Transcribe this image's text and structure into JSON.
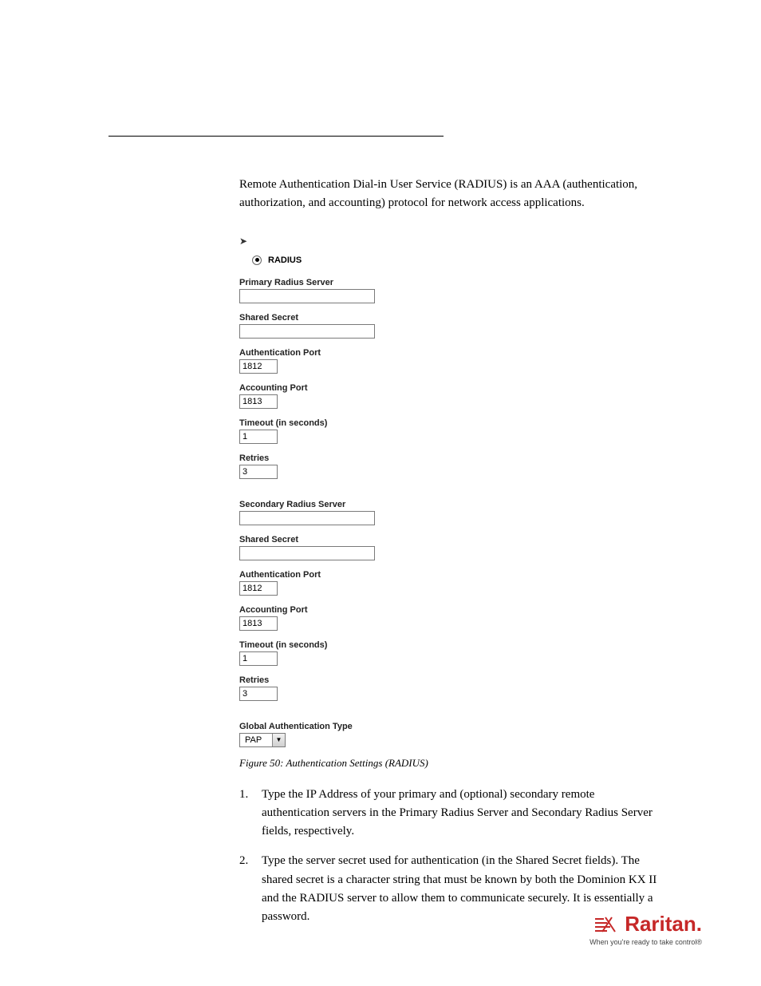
{
  "intro": "Remote Authentication Dial-in User Service (RADIUS) is an AAA (authentication, authorization, and accounting) protocol for network access applications.",
  "radius_form": {
    "radio_label": "RADIUS",
    "primary": {
      "server_label": "Primary Radius Server",
      "server_value": "",
      "shared_secret_label": "Shared Secret",
      "shared_secret_value": "",
      "auth_port_label": "Authentication Port",
      "auth_port_value": "1812",
      "acct_port_label": "Accounting Port",
      "acct_port_value": "1813",
      "timeout_label": "Timeout (in seconds)",
      "timeout_value": "1",
      "retries_label": "Retries",
      "retries_value": "3"
    },
    "secondary": {
      "server_label": "Secondary Radius Server",
      "server_value": "",
      "shared_secret_label": "Shared Secret",
      "shared_secret_value": "",
      "auth_port_label": "Authentication Port",
      "auth_port_value": "1812",
      "acct_port_label": "Accounting Port",
      "acct_port_value": "1813",
      "timeout_label": "Timeout (in seconds)",
      "timeout_value": "1",
      "retries_label": "Retries",
      "retries_value": "3"
    },
    "global_auth_label": "Global Authentication Type",
    "global_auth_value": "PAP"
  },
  "figure_caption": "Figure 50: Authentication Settings (RADIUS)",
  "steps": {
    "s1": "Type the IP Address of your primary and (optional) secondary remote authentication servers in the Primary Radius Server and Secondary Radius Server fields, respectively.",
    "s2": "Type the server secret used for authentication (in the Shared Secret fields). The shared secret is a character string that must be known by both the Dominion KX II and the RADIUS server to allow them to communicate securely. It is essentially a password."
  },
  "footer": {
    "brand": "Raritan.",
    "tagline": "When you're ready to take control®"
  }
}
